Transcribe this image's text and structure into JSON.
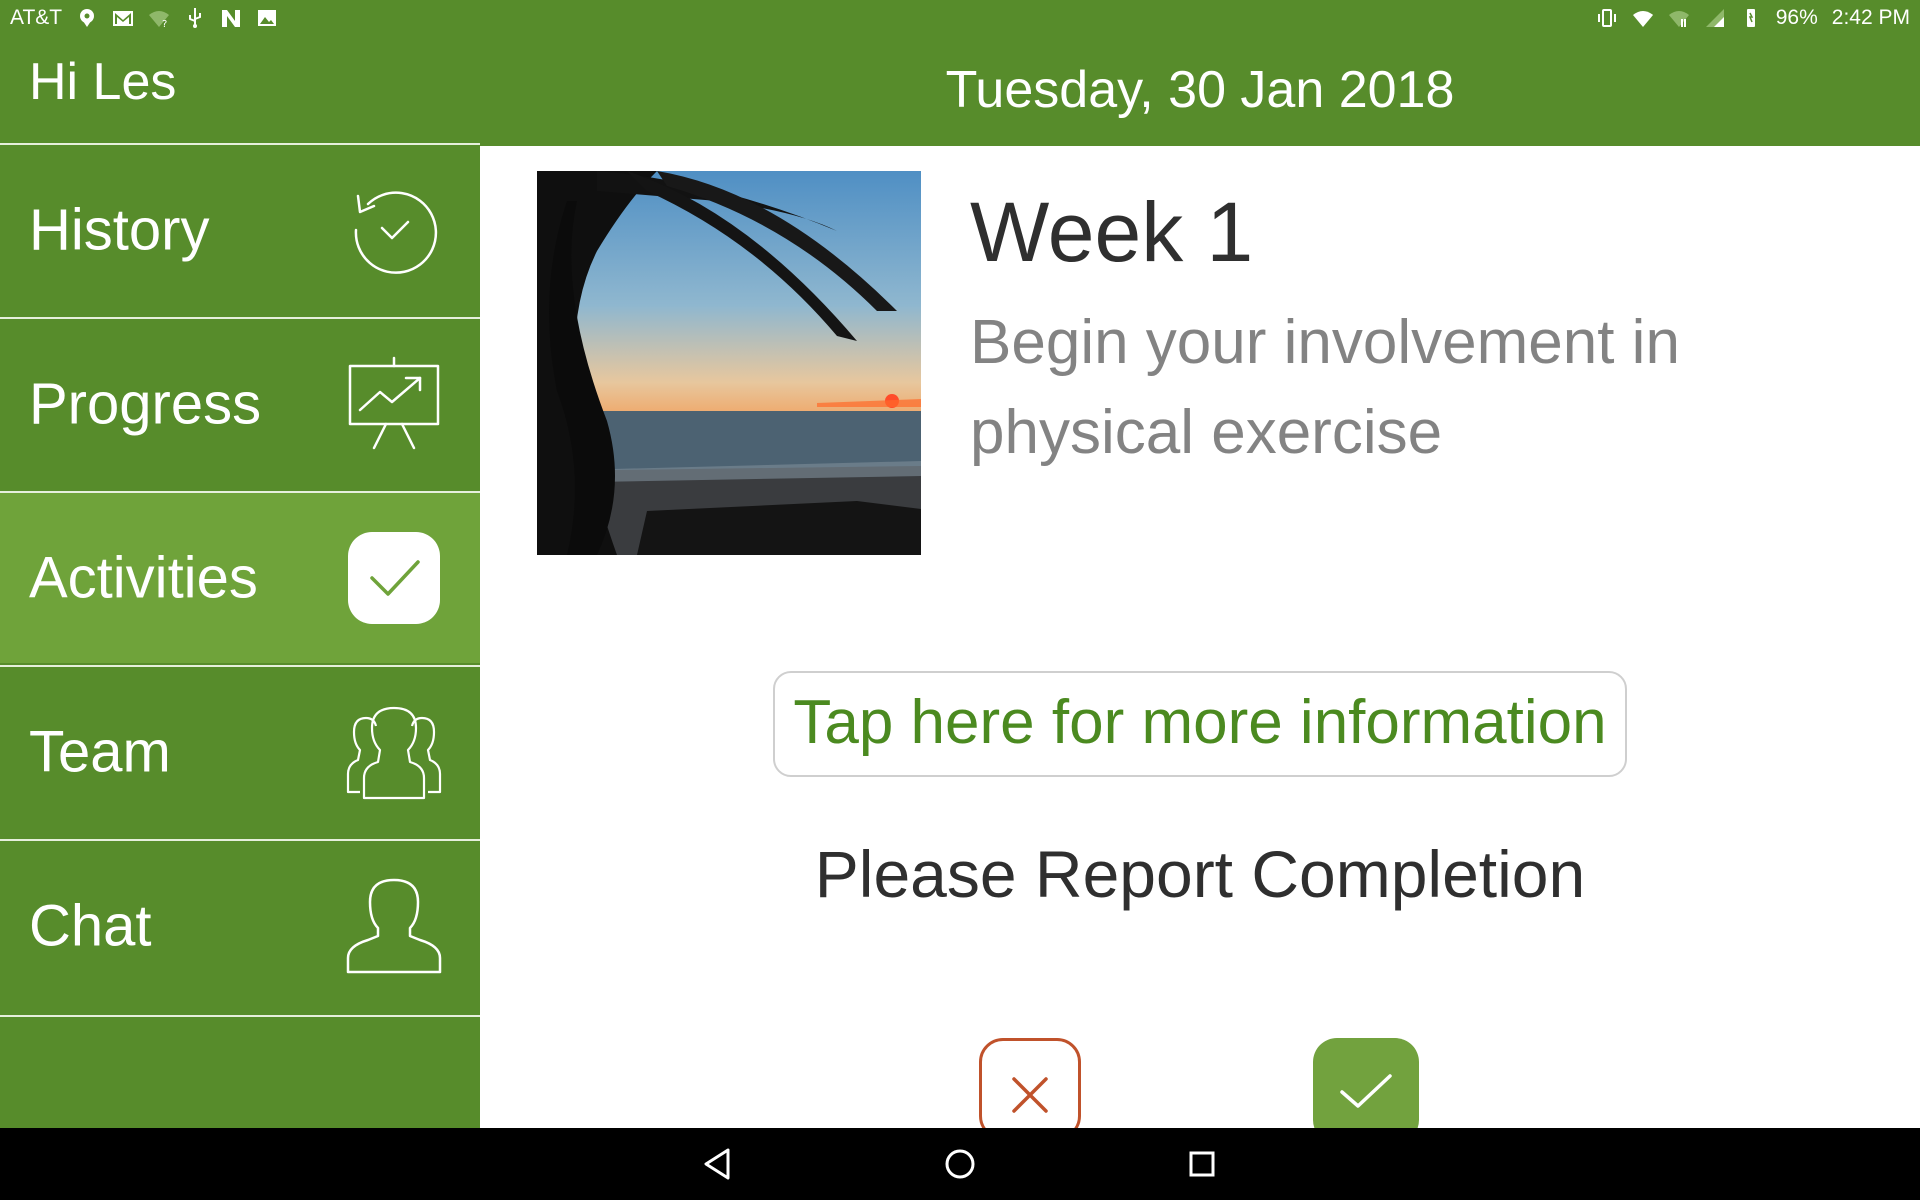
{
  "status_bar": {
    "carrier": "AT&T",
    "battery": "96%",
    "time": "2:42 PM",
    "left_icons": [
      "location-icon",
      "gmail-icon",
      "wifi-question-icon",
      "usb-icon",
      "n-icon",
      "image-icon"
    ],
    "right_icons": [
      "vibrate-icon",
      "wifi-icon",
      "data-icon",
      "signal-icon",
      "battery-icon"
    ]
  },
  "header": {
    "greeting": "Hi Les",
    "date": "Tuesday, 30 Jan 2018"
  },
  "sidebar": {
    "items": [
      {
        "label": "History",
        "icon": "history-icon",
        "active": false
      },
      {
        "label": "Progress",
        "icon": "progress-chart-icon",
        "active": false
      },
      {
        "label": "Activities",
        "icon": "checkmark-icon",
        "active": true
      },
      {
        "label": "Team",
        "icon": "team-icon",
        "active": false
      },
      {
        "label": "Chat",
        "icon": "person-icon",
        "active": false
      }
    ]
  },
  "main": {
    "week_title": "Week 1",
    "week_description": "Begin your involvement in physical exercise",
    "info_button_label": "Tap here for more information",
    "report_label": "Please Report Completion",
    "decline_icon": "close-icon",
    "confirm_icon": "check-icon"
  },
  "colors": {
    "brand_green": "#578c2b",
    "active_green": "#6fa33a",
    "link_green": "#4b8a20",
    "decline_red": "#c0522b",
    "confirm_green": "#72a23e"
  },
  "system_nav": {
    "buttons": [
      "back-icon",
      "home-icon",
      "recents-icon"
    ]
  }
}
